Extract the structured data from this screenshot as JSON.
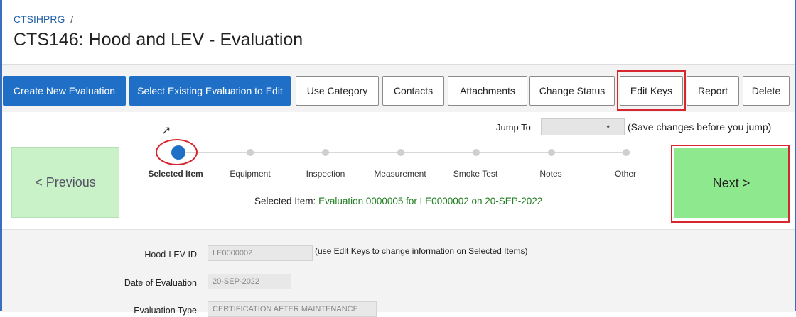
{
  "breadcrumb": {
    "root": "CTSIHPRG",
    "separator": "/"
  },
  "page_title": "CTS146: Hood and LEV - Evaluation",
  "toolbar": {
    "create": "Create New Evaluation",
    "select_existing": "Select Existing Evaluation to Edit",
    "use_category": "Use Category",
    "contacts": "Contacts",
    "attachments": "Attachments",
    "change_status": "Change Status",
    "edit_keys": "Edit Keys",
    "report": "Report",
    "delete": "Delete"
  },
  "wizard": {
    "previous": "< Previous",
    "next": "Next >",
    "jump_to_label": "Jump To",
    "jump_to_value": "",
    "jump_note": "(Save changes before you jump)",
    "steps": [
      {
        "label": "Selected Item",
        "active": true
      },
      {
        "label": "Equipment"
      },
      {
        "label": "Inspection"
      },
      {
        "label": "Measurement"
      },
      {
        "label": "Smoke Test"
      },
      {
        "label": "Notes"
      },
      {
        "label": "Other"
      }
    ],
    "selected_prefix": "Selected Item:",
    "selected_value": "Evaluation 0000005 for LE0000002 on 20-SEP-2022"
  },
  "form": {
    "hood_lev_id_label": "Hood-LEV ID",
    "hood_lev_id_value": "LE0000002",
    "hood_lev_id_note": "(use Edit Keys to change information on Selected Items)",
    "date_label": "Date of Evaluation",
    "date_value": "20-SEP-2022",
    "eval_type_label": "Evaluation Type",
    "eval_type_value": "CERTIFICATION AFTER MAINTENANCE"
  },
  "colors": {
    "primary": "#1f6fc6",
    "highlight": "#d6262e",
    "next_bg": "#8ee88e",
    "prev_bg": "#c9f2c9"
  }
}
